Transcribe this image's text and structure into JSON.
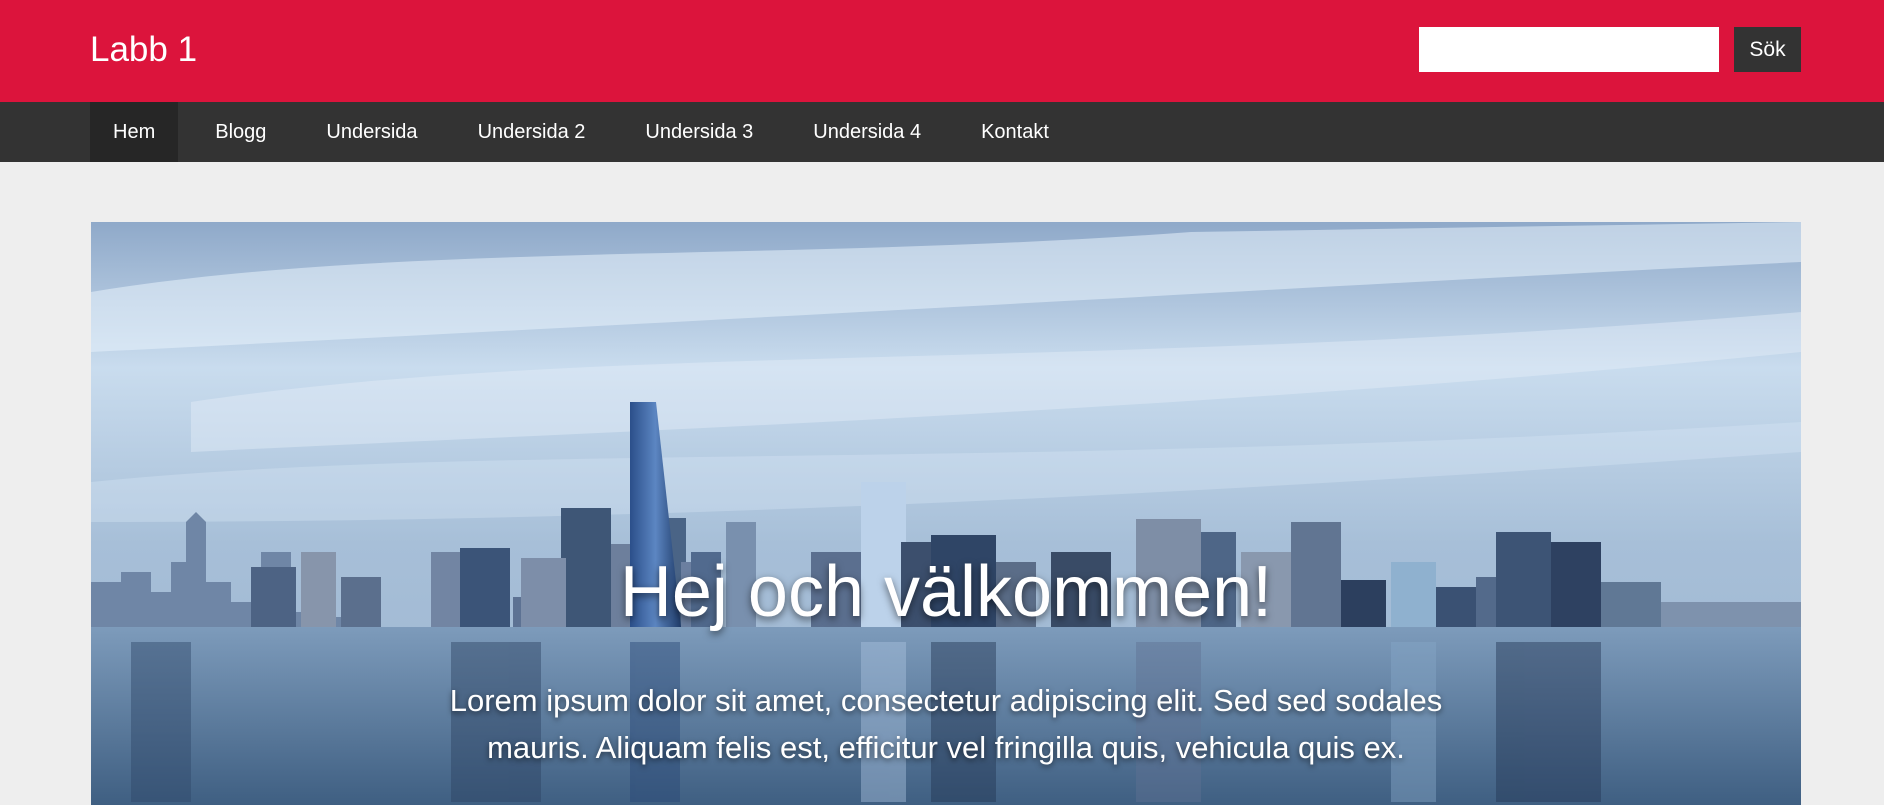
{
  "header": {
    "site_title": "Labb 1",
    "search": {
      "value": "",
      "placeholder": "",
      "button_label": "Sök"
    },
    "accent_color": "#dc143c"
  },
  "nav": {
    "items": [
      {
        "label": "Hem",
        "active": true
      },
      {
        "label": "Blogg",
        "active": false
      },
      {
        "label": "Undersida",
        "active": false
      },
      {
        "label": "Undersida 2",
        "active": false
      },
      {
        "label": "Undersida 3",
        "active": false
      },
      {
        "label": "Undersida 4",
        "active": false
      },
      {
        "label": "Kontakt",
        "active": false
      }
    ],
    "background_color": "#333333"
  },
  "hero": {
    "title": "Hej och välkommen!",
    "text": "Lorem ipsum dolor sit amet, consectetur adipiscing elit. Sed sed sodales mauris. Aliquam felis est, efficitur vel fringilla quis, vehicula quis ex.",
    "image_subject": "city-skyline-image"
  }
}
